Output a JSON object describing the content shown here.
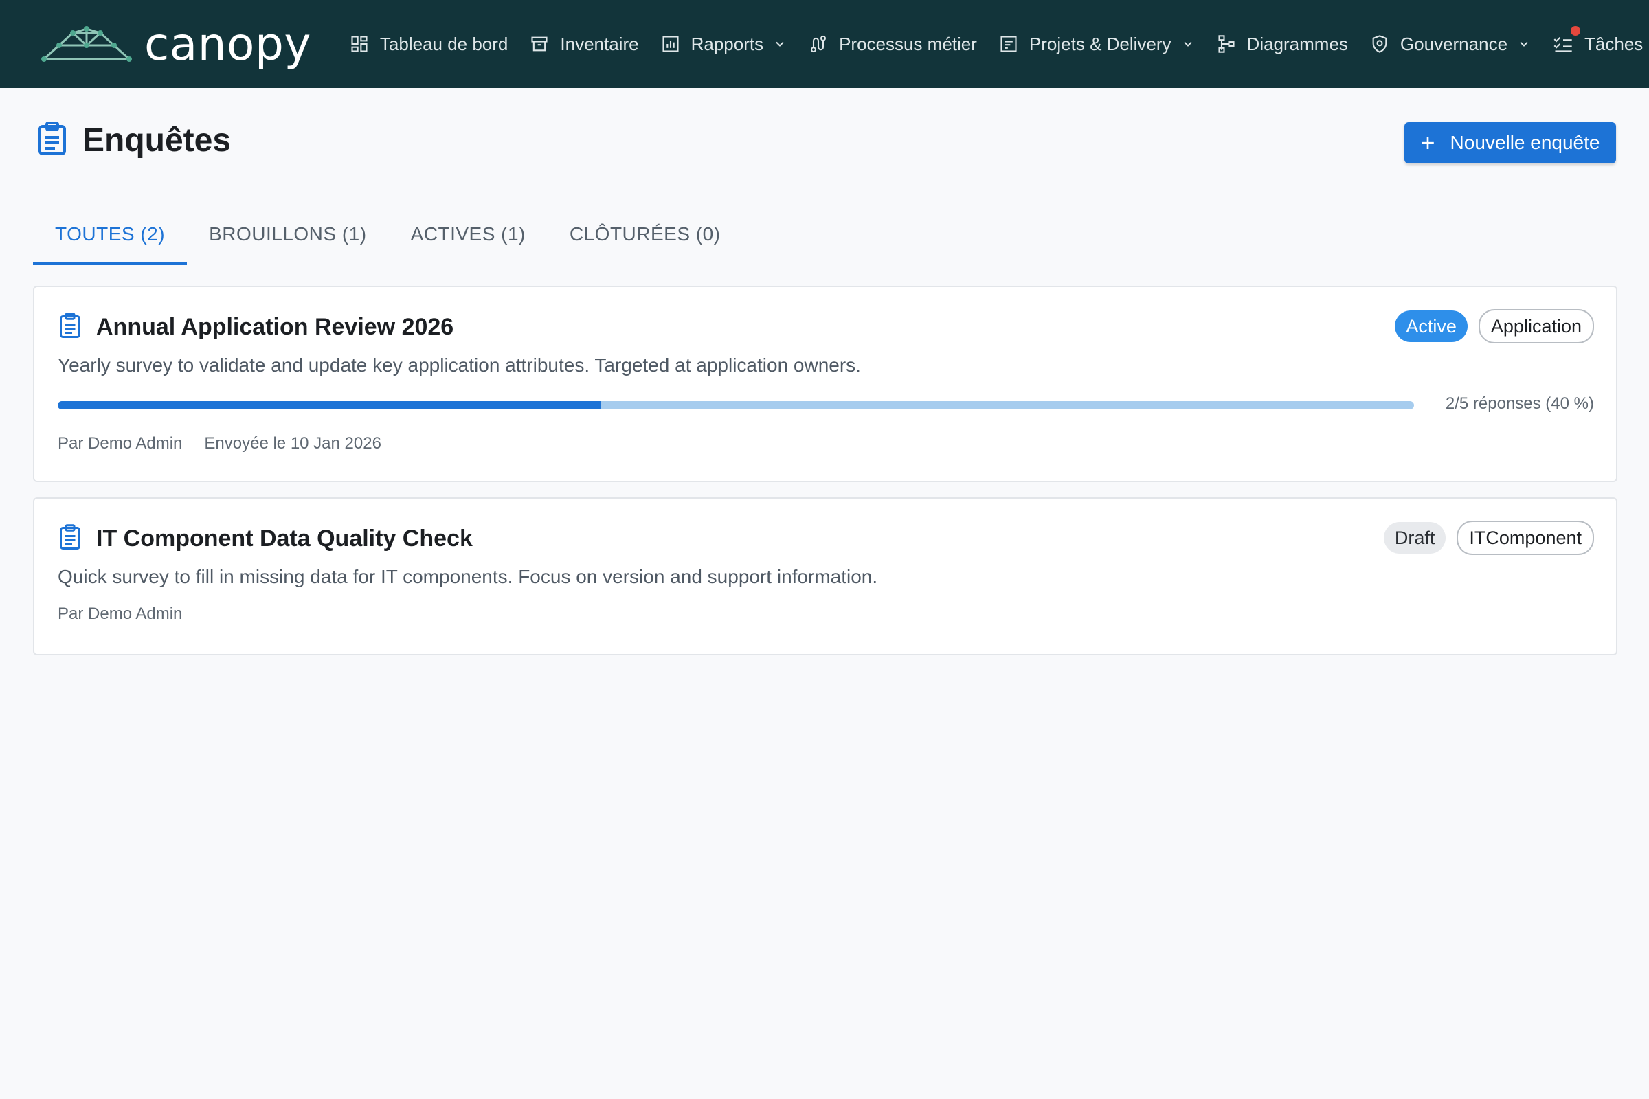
{
  "brand": {
    "name": "canopy"
  },
  "nav": {
    "items": [
      {
        "label": "Tableau de bord",
        "icon": "dashboard-icon",
        "has_dropdown": false
      },
      {
        "label": "Inventaire",
        "icon": "archive-icon",
        "has_dropdown": false
      },
      {
        "label": "Rapports",
        "icon": "bar-chart-icon",
        "has_dropdown": true
      },
      {
        "label": "Processus métier",
        "icon": "route-icon",
        "has_dropdown": false
      },
      {
        "label": "Projets & Delivery",
        "icon": "project-board-icon",
        "has_dropdown": true
      },
      {
        "label": "Diagrammes",
        "icon": "hierarchy-icon",
        "has_dropdown": false
      },
      {
        "label": "Gouvernance",
        "icon": "shield-icon",
        "has_dropdown": true
      },
      {
        "label": "Tâches",
        "icon": "checklist-icon",
        "has_dropdown": false,
        "has_notification": true
      }
    ]
  },
  "page": {
    "title": "Enquêtes",
    "new_button_label": "Nouvelle enquête",
    "new_button_icon": "plus-icon"
  },
  "tabs": [
    {
      "label": "TOUTES (2)",
      "active": true
    },
    {
      "label": "BROUILLONS (1)",
      "active": false
    },
    {
      "label": "ACTIVES (1)",
      "active": false
    },
    {
      "label": "CLÔTURÉES (0)",
      "active": false
    }
  ],
  "surveys": [
    {
      "title": "Annual Application Review 2026",
      "description": "Yearly survey to validate and update key application attributes. Targeted at application owners.",
      "status": "Active",
      "type": "Application",
      "progress_fraction": 0.4,
      "progress_label": "2/5 réponses (40 %)",
      "author": "Par Demo Admin",
      "sent": "Envoyée le 10 Jan 2026"
    },
    {
      "title": "IT Component Data Quality Check",
      "description": "Quick survey to fill in missing data for IT components. Focus on version and support information.",
      "status": "Draft",
      "type": "ITComponent",
      "author": "Par Demo Admin"
    }
  ],
  "colors": {
    "nav_bg": "#12343a",
    "accent": "#1d73d6",
    "status_active": "#2e8fea",
    "progress_track": "#a6ccee",
    "notification": "#e5483d"
  }
}
